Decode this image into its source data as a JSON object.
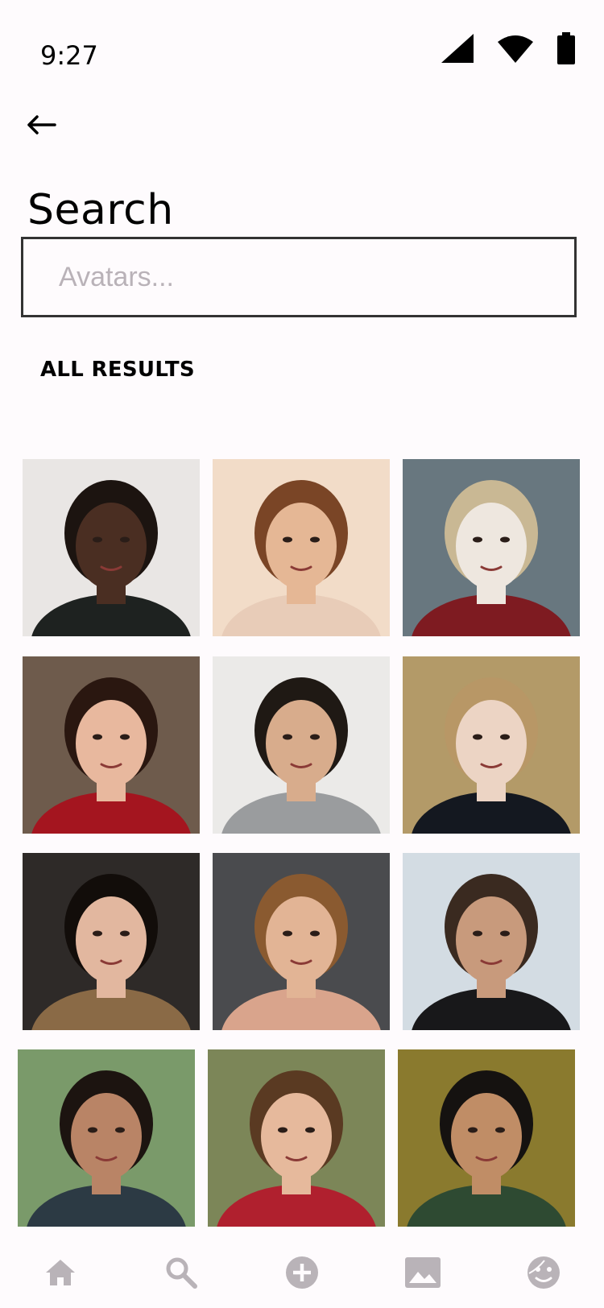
{
  "status_bar": {
    "time": "9:27",
    "icons": [
      "signal-icon",
      "wifi-icon",
      "battery-icon"
    ]
  },
  "header": {
    "back_icon": "arrow-left-icon",
    "title": "Search"
  },
  "search": {
    "placeholder": "Avatars...",
    "value": ""
  },
  "results": {
    "label": "ALL RESULTS",
    "avatars": [
      {
        "bg": "#e9e6e4",
        "skin": "#4a2e22",
        "hair": "#1c1410",
        "shirt": "#1e2220"
      },
      {
        "bg": "#f2dcc8",
        "skin": "#e5b795",
        "hair": "#7a4526",
        "shirt": "#e8ccb8"
      },
      {
        "bg": "#68777f",
        "skin": "#eee7df",
        "hair": "#c9b894",
        "shirt": "#7e1b21"
      },
      {
        "bg": "#6e5b4c",
        "skin": "#e8b89e",
        "hair": "#2a1710",
        "shirt": "#a4151f"
      },
      {
        "bg": "#ebeae8",
        "skin": "#d8ac8c",
        "hair": "#1f1914",
        "shirt": "#9a9c9e"
      },
      {
        "bg": "#b39a68",
        "skin": "#ecd4c4",
        "hair": "#b89766",
        "shirt": "#141820"
      },
      {
        "bg": "#2e2a28",
        "skin": "#e2b79f",
        "hair": "#120d0a",
        "shirt": "#8a6a46"
      },
      {
        "bg": "#4a4b4e",
        "skin": "#e2b495",
        "hair": "#8a5a30",
        "shirt": "#d9a48c"
      },
      {
        "bg": "#d3dce3",
        "skin": "#c89a7c",
        "hair": "#3a2a20",
        "shirt": "#18181a"
      },
      {
        "bg": "#7a9a6a",
        "skin": "#b98466",
        "hair": "#1c1410",
        "shirt": "#2c3a44"
      },
      {
        "bg": "#7c8658",
        "skin": "#e6b99c",
        "hair": "#5a3a22",
        "shirt": "#b0202e"
      },
      {
        "bg": "#8a7a2e",
        "skin": "#c08d66",
        "hair": "#151210",
        "shirt": "#2e4a32"
      }
    ]
  },
  "bottom_nav": {
    "items": [
      {
        "icon": "home-icon"
      },
      {
        "icon": "search-icon"
      },
      {
        "icon": "add-circle-icon"
      },
      {
        "icon": "image-icon"
      },
      {
        "icon": "face-icon"
      }
    ],
    "icon_color": "#b9b3b8"
  }
}
